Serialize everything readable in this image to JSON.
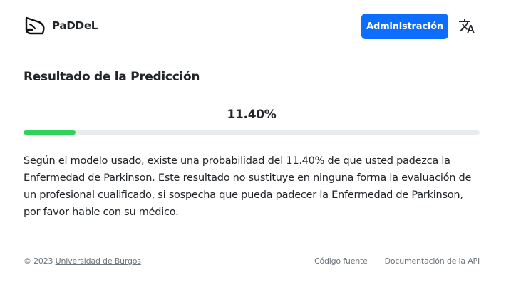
{
  "navbar": {
    "brand_name": "PaDDeL",
    "logo_icon": "paddel-logo-icon",
    "admin_button_label": "Administración",
    "language_icon": "translate-icon",
    "accent_color": "#0d6efd"
  },
  "main": {
    "title": "Resultado de la Predicción",
    "probability_label": "11.40%",
    "probability_fraction": 0.114,
    "progress_color": "#2fd35b",
    "result_text": "Según el modelo usado, existe una probabilidad del 11.40% de que usted padezca la Enfermedad de Parkinson. Este resultado no sustituye en ninguna forma la evaluación de un profesional cualificado, si sospecha que pueda padecer la Enfermedad de Parkinson, por favor hable con su médico."
  },
  "footer": {
    "copyright_prefix": "© 2023 ",
    "university_link": "Universidad de Burgos",
    "source_code_link": "Código fuente",
    "api_docs_link": "Documentación de la API"
  }
}
